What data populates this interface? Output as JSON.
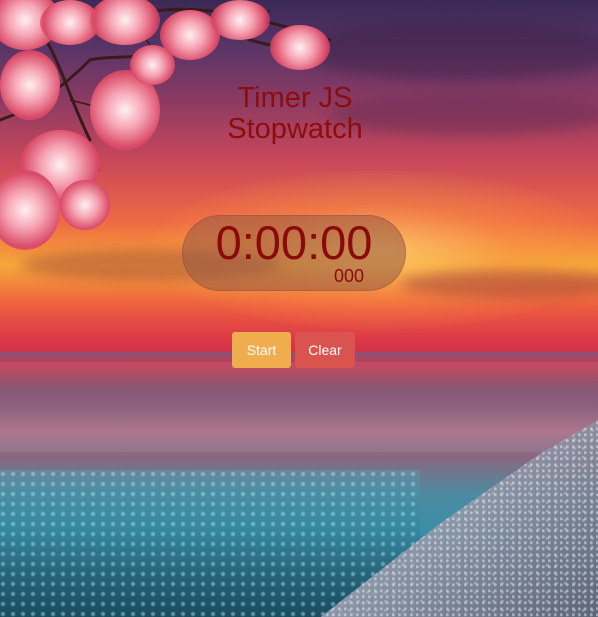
{
  "header": {
    "title_line1": "Timer JS",
    "title_line2": "Stopwatch"
  },
  "display": {
    "time": "0:00:00",
    "milliseconds": "000"
  },
  "controls": {
    "start_label": "Start",
    "clear_label": "Clear"
  },
  "colors": {
    "title_text": "#8b0d0d",
    "display_text": "#8a0a0a",
    "start_button": "#f0ad4e",
    "clear_button": "#d9534f"
  },
  "background": {
    "scene": "sunset sea with cherry blossom branch and pebble beach"
  }
}
